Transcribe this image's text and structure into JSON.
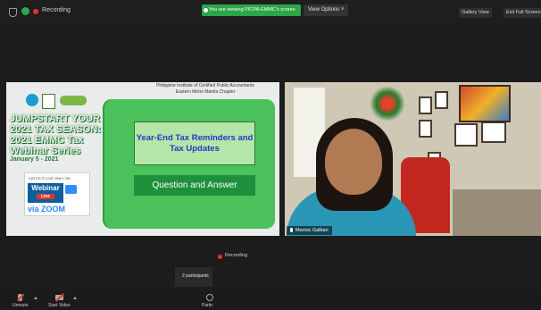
{
  "window": {
    "recording_label": "Recording",
    "view_banner": "You are viewing PICPA-EMMC's screen",
    "view_options": "View Options ˅",
    "gallery_view": "Gallery View",
    "exit_full_screen": "Exit Full Screen"
  },
  "slide": {
    "header_line1": "Philippine Institute of Certified Public Accountants",
    "header_line2": "Eastern Metro Manila Chapter",
    "headline_line1": "JUMPSTART YOUR",
    "headline_line2": "2021 TAX SEASON:",
    "headline_line3": "2021 EMMC Tax",
    "headline_line4": "Webinar Series",
    "dates": "January 5 - 2021",
    "badge_top": "CATCH IT LIVE ONLY ON",
    "badge_webinar": "Webinar",
    "badge_live": "Live",
    "badge_platform": "via ZOOM",
    "topic1": "Year-End Tax Reminders and Tax Updates",
    "topic2": "Question and Answer"
  },
  "video": {
    "speaker_name": "Marivic Galban"
  },
  "meeting": {
    "recording_label": "Recording",
    "participants_label": "2 participants"
  },
  "toolbar": {
    "unmute": "Unmute",
    "start_video": "Start Video",
    "participants": "Partic"
  },
  "colors": {
    "banner_green": "#2da54a",
    "slide_green": "#4bc15b",
    "topic_text_blue": "#1a3cc8",
    "recording_red": "#e5322d"
  },
  "icons": [
    "shield-icon",
    "encryption-icon",
    "record-icon",
    "microphone-muted-icon",
    "video-off-icon",
    "participants-icon"
  ]
}
